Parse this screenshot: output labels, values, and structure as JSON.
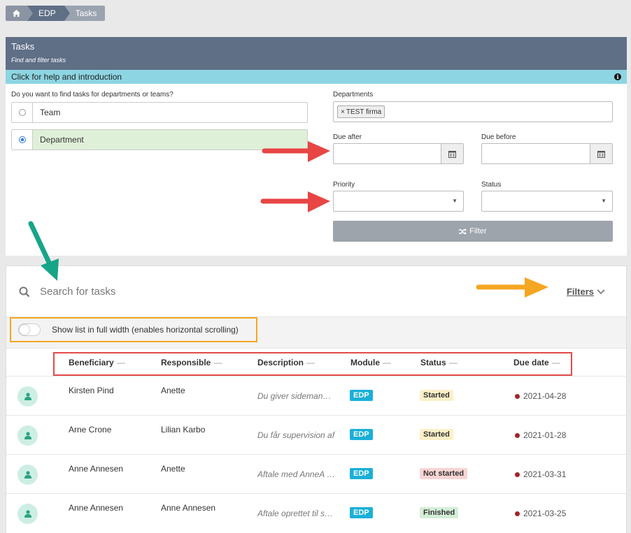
{
  "breadcrumb": {
    "home_icon": "home-icon",
    "items": [
      "EDP",
      "Tasks"
    ]
  },
  "panel": {
    "title": "Tasks",
    "subtitle": "Find and filter tasks",
    "help": "Click for help and introduction",
    "question": "Do you want to find tasks for departments or teams?",
    "options": [
      "Team",
      "Department"
    ],
    "selected": "Department",
    "departments_label": "Departments",
    "department_chip": "TEST firma",
    "due_after_label": "Due after",
    "due_before_label": "Due before",
    "priority_label": "Priority",
    "status_label": "Status",
    "filter_button": "Filter"
  },
  "list": {
    "search_placeholder": "Search for tasks",
    "filters_link": "Filters",
    "toggle_label": "Show list in full width (enables horizontal scrolling)",
    "columns": [
      "Beneficiary",
      "Responsible",
      "Description",
      "Module",
      "Status",
      "Due date"
    ],
    "rows": [
      {
        "beneficiary": "Kirsten Pind",
        "responsible": "Anette",
        "description": "Du giver sidemandsoplæring",
        "module": "EDP",
        "status": "Started",
        "due": "2021-04-28"
      },
      {
        "beneficiary": "Arne Crone",
        "responsible": "Lilian Karbo",
        "description": "Du får supervision af",
        "module": "EDP",
        "status": "Started",
        "due": "2021-01-28"
      },
      {
        "beneficiary": "Anne Annesen",
        "responsible": "Anette",
        "description": "Aftale med AnneA om",
        "module": "EDP",
        "status": "Not started",
        "due": "2021-03-31"
      },
      {
        "beneficiary": "Anne Annesen",
        "responsible": "Anne Annesen",
        "description": "Aftale oprettet til seminar",
        "module": "EDP",
        "status": "Finished",
        "due": "2021-03-25"
      }
    ]
  },
  "colors": {
    "header": "#5f6f86",
    "help_bar": "#8dd5e3",
    "arrow_red": "#e84545",
    "arrow_green": "#16a589",
    "arrow_orange": "#f5a623"
  }
}
